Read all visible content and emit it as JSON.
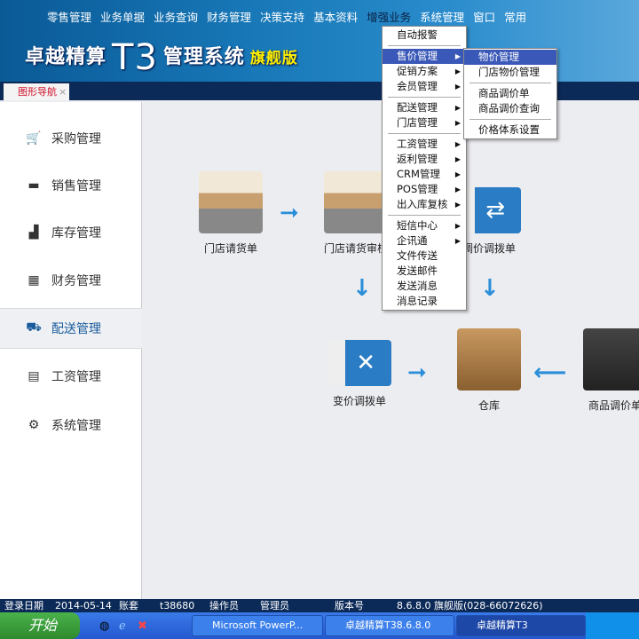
{
  "menubar": [
    "零售管理",
    "业务单据",
    "业务查询",
    "财务管理",
    "决策支持",
    "基本资料",
    "增强业务",
    "系统管理",
    "窗口",
    "常用"
  ],
  "logo": {
    "name": "卓越精算",
    "version": "T3",
    "system": "管理系统",
    "edition": "旗舰版"
  },
  "tab": {
    "label": "图形导航",
    "close": "×"
  },
  "sidebar": [
    {
      "label": "采购管理",
      "icon": "cart-icon"
    },
    {
      "label": "销售管理",
      "icon": "money-icon"
    },
    {
      "label": "库存管理",
      "icon": "warehouse-icon"
    },
    {
      "label": "财务管理",
      "icon": "calculator-icon"
    },
    {
      "label": "配送管理",
      "icon": "truck-icon"
    },
    {
      "label": "工资管理",
      "icon": "cash-icon"
    },
    {
      "label": "系统管理",
      "icon": "gear-icon"
    }
  ],
  "flow": {
    "n1": "门店请货单",
    "n2": "门店请货审核",
    "n3": "调价调拨单",
    "n4": "变价调拨单",
    "n5": "仓库",
    "n6": "商品调价单"
  },
  "menu": {
    "items": [
      "自动报警",
      "售价管理",
      "促销方案",
      "会员管理",
      "配送管理",
      "门店管理",
      "工资管理",
      "返利管理",
      "CRM管理",
      "POS管理",
      "出入库复核",
      "短信中心",
      "企讯通",
      "文件传送",
      "发送邮件",
      "发送消息",
      "消息记录"
    ]
  },
  "submenu": [
    "物价管理",
    "门店物价管理",
    "商品调价单",
    "商品调价查询",
    "价格体系设置"
  ],
  "status": {
    "date_label": "登录日期",
    "date": "2014-05-14",
    "account_label": "账套",
    "account": "t38680",
    "operator_label": "操作员",
    "operator": "管理员",
    "version_label": "版本号",
    "version": "8.6.8.0 旗舰版(028-66072626)"
  },
  "taskbar": {
    "start": "开始",
    "tasks": [
      "Microsoft PowerP...",
      "卓越精算T38.6.8.0",
      "卓越精算T3"
    ]
  }
}
